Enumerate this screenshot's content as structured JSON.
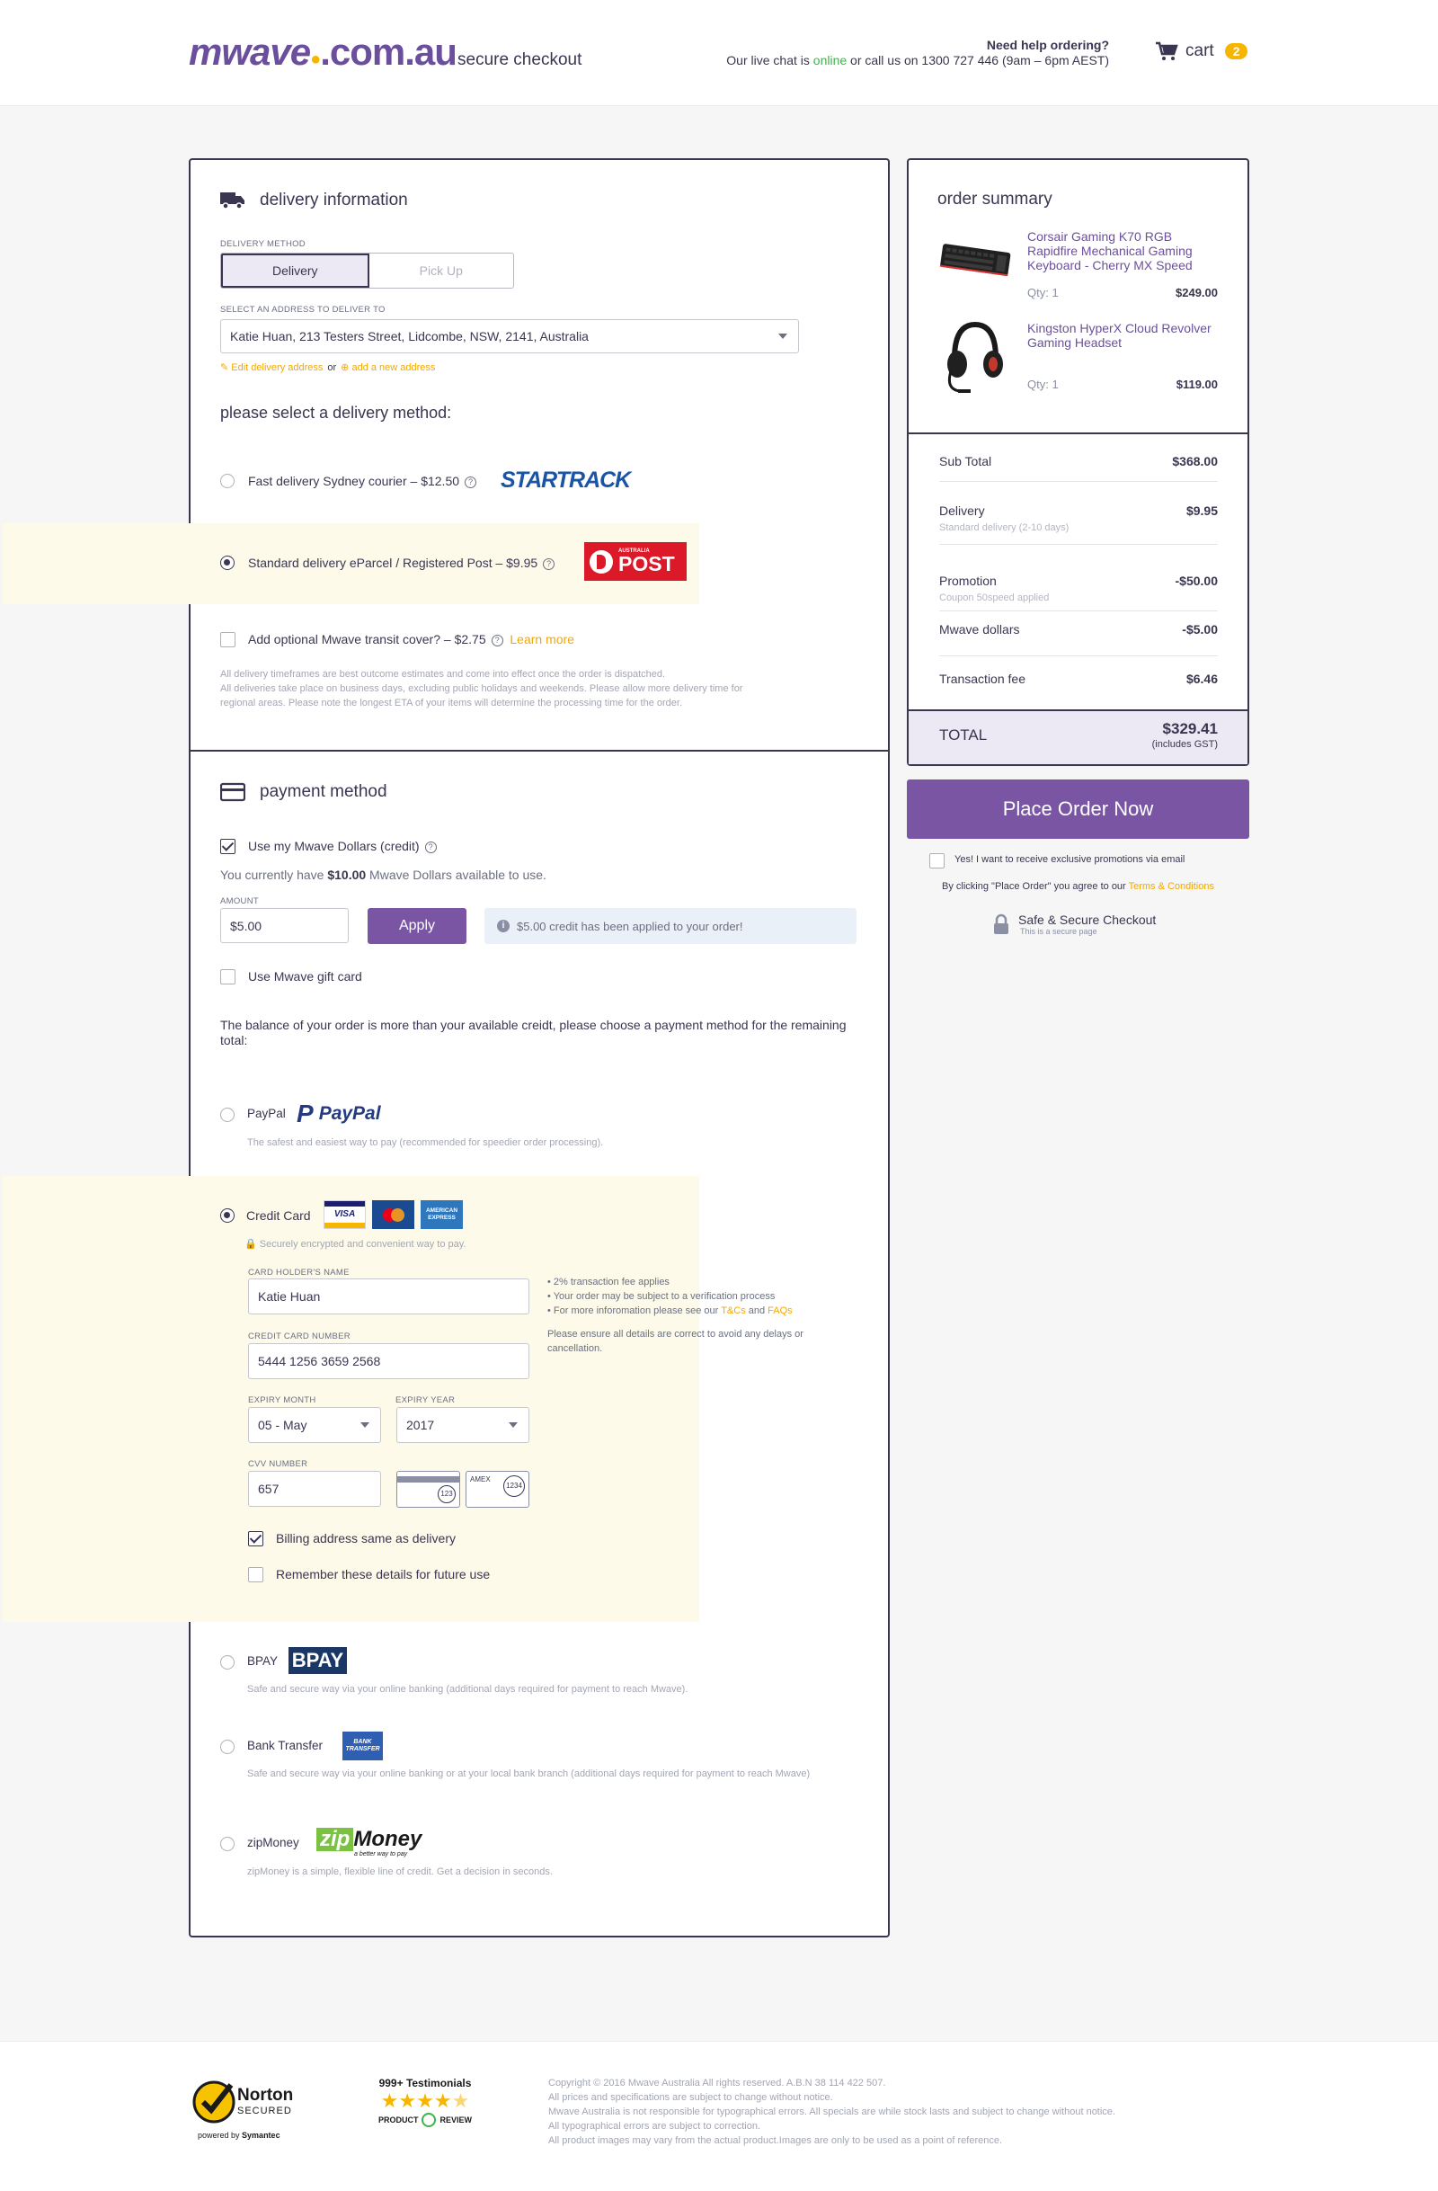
{
  "header": {
    "logo_main": "mwave",
    "logo_domain": ".com.au",
    "title": "secure checkout",
    "help_title": "Need help ordering?",
    "help_prefix": "Our live chat is ",
    "help_online": "online",
    "help_suffix": " or call us on 1300 727 446 (9am – 6pm AEST)",
    "cart_label": "cart",
    "cart_count": "2",
    "cart_icon": "cart-icon"
  },
  "delivery": {
    "title": "delivery information",
    "icon": "truck-icon",
    "method_label": "DELIVERY METHOD",
    "method_options": [
      "Delivery",
      "Pick Up"
    ],
    "method_selected": "Delivery",
    "address_label": "SELECT AN ADDRESS TO DELIVER TO",
    "address_value": "Katie Huan, 213 Testers Street, Lidcombe, NSW, 2141, Australia",
    "edit_link": "Edit delivery address",
    "or_text": "or",
    "add_link": "add a new address",
    "select_heading": "please select a delivery method:",
    "options": [
      {
        "label": "Fast delivery Sydney courier – $12.50",
        "logo": "STARTRACK",
        "selected": false
      },
      {
        "label": "Standard delivery eParcel / Registered Post – $9.95",
        "logo": "POST",
        "logo_small": "AUSTRALIA",
        "selected": true
      }
    ],
    "transit_cover": "Add optional Mwave transit cover? – $2.75",
    "learn_more": "Learn more",
    "fine_print": [
      "All delivery timeframes are best outcome estimates and come into effect once the order is dispatched.",
      "All deliveries take place on business days, excluding public holidays and weekends. Please allow more delivery time for",
      "regional areas. Please note the longest ETA of your items will determine the processing time for the order."
    ]
  },
  "payment": {
    "title": "payment method",
    "icon": "credit-card-icon",
    "use_dollars": "Use my Mwave Dollars (credit)",
    "balance_prefix": "You currently have ",
    "balance_amount": "$10.00",
    "balance_suffix": " Mwave Dollars available to use.",
    "amount_label": "AMOUNT",
    "amount_value": "$5.00",
    "apply_label": "Apply",
    "applied_msg": "$5.00 credit has been applied to your order!",
    "gift_card": "Use Mwave gift card",
    "balance_note": "The balance of your order is more than your available creidt, please choose a payment method for the remaining total:",
    "paypal": {
      "label": "PayPal",
      "logo": "PayPal",
      "desc": "The safest and easiest way to pay (recommended for speedier order processing)."
    },
    "credit_card": {
      "label": "Credit Card",
      "secure_note": "Securely encrypted and convenient way to pay.",
      "holder_label": "CARD HOLDER'S NAME",
      "holder_value": "Katie Huan",
      "number_label": "CREDIT CARD NUMBER",
      "number_value": "5444 1256 3659 2568",
      "month_label": "EXPIRY MONTH",
      "month_value": "05 - May",
      "year_label": "EXPIRY YEAR",
      "year_value": "2017",
      "cvv_label": "CVV NUMBER",
      "cvv_value": "657",
      "notes": [
        "• 2% transaction fee applies",
        "• Your order may be subject to a verification process"
      ],
      "note_faq_prefix": "• For more inforomation please see our ",
      "note_tcs": "T&Cs",
      "note_and": " and ",
      "note_faqs": "FAQs",
      "ensure": "Please ensure all details are correct to avoid any delays or cancellation.",
      "billing_same": "Billing address same as delivery",
      "remember": "Remember these details for future use",
      "visa": "VISA",
      "amex": "AMERICAN EXPRESS",
      "cvv_sample": "123",
      "amex_sample": "1234",
      "amex_label": "AMEX"
    },
    "bpay": {
      "label": "BPAY",
      "logo": "BPAY",
      "desc": "Safe and secure way via your online banking (additional days required for payment to reach Mwave)."
    },
    "bank": {
      "label": "Bank Transfer",
      "logo": "BANK TRANSFER",
      "desc": "Safe and secure way via your online banking or at your local bank branch (additional days required for payment to reach Mwave)"
    },
    "zip": {
      "label": "zipMoney",
      "logo_a": "zip",
      "logo_b": "Money",
      "tagline": "a better way to pay",
      "desc": "zipMoney is a simple, flexible line of credit. Get a decision in seconds."
    }
  },
  "summary": {
    "title": "order summary",
    "items": [
      {
        "name": "Corsair Gaming K70 RGB Rapidfire Mechanical Gaming Keyboard - Cherry MX Speed",
        "qty": "Qty: 1",
        "price": "$249.00",
        "icon": "keyboard-icon"
      },
      {
        "name": "Kingston HyperX Cloud Revolver Gaming Headset",
        "qty": "Qty: 1",
        "price": "$119.00",
        "icon": "headset-icon"
      }
    ],
    "subtotal_label": "Sub Total",
    "subtotal": "$368.00",
    "delivery_label": "Delivery",
    "delivery": "$9.95",
    "delivery_sub": "Standard delivery (2-10 days)",
    "promo_label": "Promotion",
    "promo": "-$50.00",
    "promo_sub": "Coupon 50speed applied",
    "dollars_label": "Mwave dollars",
    "dollars": "-$5.00",
    "fee_label": "Transaction fee",
    "fee": "$6.46",
    "total_label": "TOTAL",
    "total": "$329.41",
    "total_sub": "(includes GST)",
    "place_order": "Place Order Now",
    "promo_opt": "Yes! I want to receive exclusive promotions via email",
    "agree_prefix": "By clicking \"Place Order\" you agree to our ",
    "terms": "Terms & Conditions",
    "secure_title": "Safe & Secure Checkout",
    "secure_sub": "This is a secure page"
  },
  "footer": {
    "norton_main": "Norton",
    "norton_secured": "SECURED",
    "norton_by": "powered by",
    "norton_sym": "Symantec",
    "testimonials": "999+ Testimonials",
    "pr_a": "PRODUCT",
    "pr_b": "REVIEW",
    "rating": 4.5,
    "legal": [
      "Copyright © 2016 Mwave Australia All rights reserved. A.B.N 38 114 422 507.",
      "All prices and specifications are subject to change without notice.",
      "Mwave Australia is not responsible for typographical errors. All specials are while stock lasts and subject to change without notice.",
      "All typographical errors are subject to correction.",
      "All product images may vary from the actual product.Images are only to be used as a point of reference."
    ]
  },
  "colors": {
    "brand": "#6b4f9e",
    "accent": "#f7b500",
    "dark": "#3a3651",
    "highlight": "#fdfaea"
  }
}
